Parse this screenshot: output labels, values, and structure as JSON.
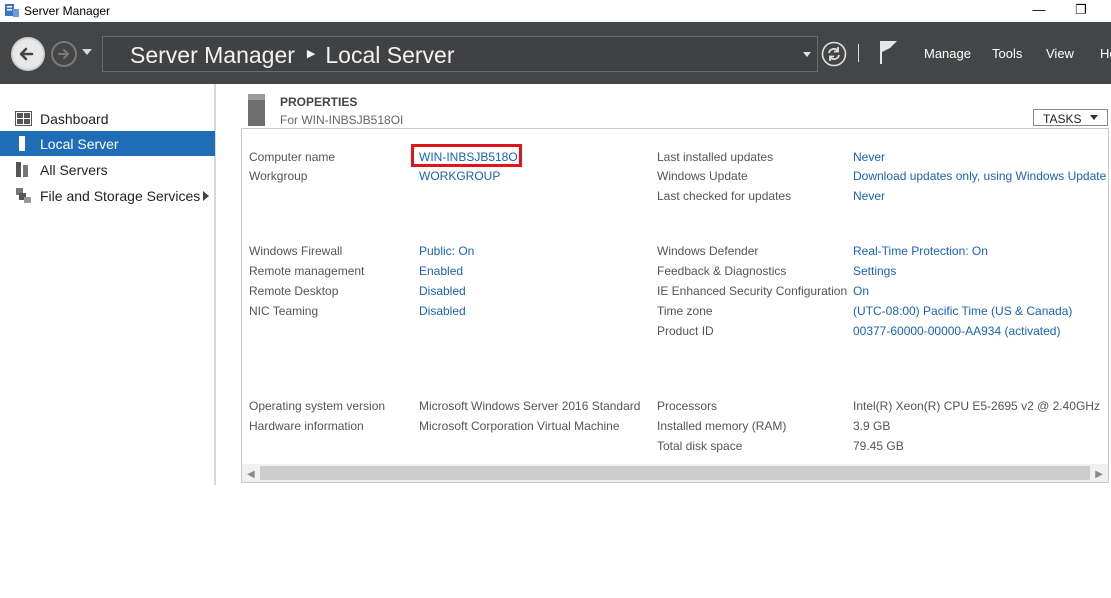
{
  "window": {
    "title": "Server Manager",
    "icon": "server-manager-icon",
    "minimize_glyph": "—",
    "restore_glyph": "❐"
  },
  "nav": {
    "breadcrumb_app": "Server Manager",
    "breadcrumb_separator": "▶",
    "breadcrumb_page": "Local Server",
    "menu": [
      "Manage",
      "Tools",
      "View",
      "Help"
    ]
  },
  "sidebar": {
    "items": [
      {
        "label": "Dashboard",
        "icon": "dashboard-icon",
        "active": false
      },
      {
        "label": "Local Server",
        "icon": "local-server-icon",
        "active": true
      },
      {
        "label": "All Servers",
        "icon": "all-servers-icon",
        "active": false
      },
      {
        "label": "File and Storage Services",
        "icon": "storage-icon",
        "active": false,
        "has_submenu": true
      }
    ]
  },
  "properties": {
    "title": "PROPERTIES",
    "subtitle": "For WIN-INBSJB518OI",
    "tasks_label": "TASKS",
    "left_groups": [
      [
        {
          "label": "Computer name",
          "value": "WIN-INBSJB518OI",
          "link": true,
          "highlighted": true
        },
        {
          "label": "Workgroup",
          "value": "WORKGROUP",
          "link": true
        }
      ],
      [
        {
          "label": "Windows Firewall",
          "value": "Public: On",
          "link": true
        },
        {
          "label": "Remote management",
          "value": "Enabled",
          "link": true
        },
        {
          "label": "Remote Desktop",
          "value": "Disabled",
          "link": true
        },
        {
          "label": "NIC Teaming",
          "value": "Disabled",
          "link": true
        }
      ],
      [
        {
          "label": "Operating system version",
          "value": "Microsoft Windows Server 2016 Standard",
          "link": false
        },
        {
          "label": "Hardware information",
          "value": "Microsoft Corporation Virtual Machine",
          "link": false
        }
      ]
    ],
    "right_groups": [
      [
        {
          "label": "Last installed updates",
          "value": "Never",
          "link": true
        },
        {
          "label": "Windows Update",
          "value": "Download updates only, using Windows Update",
          "link": true
        },
        {
          "label": "Last checked for updates",
          "value": "Never",
          "link": true
        }
      ],
      [
        {
          "label": "Windows Defender",
          "value": "Real-Time Protection: On",
          "link": true
        },
        {
          "label": "Feedback & Diagnostics",
          "value": "Settings",
          "link": true
        },
        {
          "label": "IE Enhanced Security Configuration",
          "value": "On",
          "link": true
        },
        {
          "label": "Time zone",
          "value": "(UTC-08:00) Pacific Time (US & Canada)",
          "link": true
        },
        {
          "label": "Product ID",
          "value": "00377-60000-00000-AA934 (activated)",
          "link": true
        }
      ],
      [
        {
          "label": "Processors",
          "value": "Intel(R) Xeon(R) CPU E5-2695 v2 @ 2.40GHz",
          "link": false
        },
        {
          "label": "Installed memory (RAM)",
          "value": "3.9 GB",
          "link": false
        },
        {
          "label": "Total disk space",
          "value": "79.45 GB",
          "link": false
        }
      ]
    ]
  },
  "colors": {
    "navbar": "#444546",
    "active_item": "#1e6db6",
    "link": "#1a62b4",
    "highlight_box": "#e0151b"
  }
}
